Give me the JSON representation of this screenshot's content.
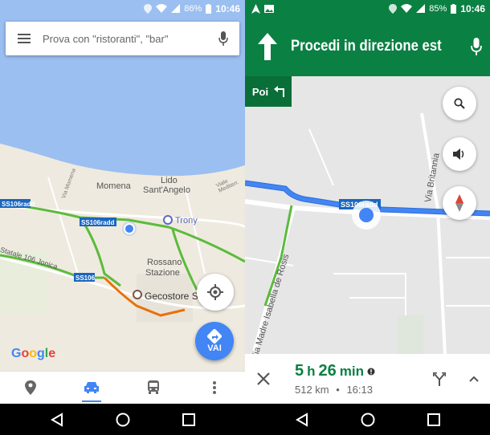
{
  "left": {
    "status": {
      "battery": "86%",
      "time": "10:46"
    },
    "search": {
      "placeholder": "Prova con \"ristoranti\", \"bar\""
    },
    "map_labels": {
      "momena": "Momena",
      "lido": "Lido",
      "santangelo": "Sant'Angelo",
      "trony": "Trony",
      "rossano": "Rossano",
      "stazione": "Stazione",
      "gecostore": "Gecostore S",
      "statale": "Statale 106 Jonica",
      "ss106radd_a": "SS106radd",
      "ss106radd_b": "SS106radd",
      "ss106": "SS106",
      "via_momena": "Via Momena",
      "viale": "Viale Mediterr."
    },
    "vai_label": "VAI",
    "google": "Google"
  },
  "right": {
    "status": {
      "battery": "85%",
      "time": "10:46"
    },
    "instruction": "Procedi in direzione est",
    "then_label": "Poi",
    "map_labels": {
      "via_britannia": "Via Britannia",
      "madre": "Via Madre Isabella de Rosis",
      "ss106radd": "SS106radd"
    },
    "trip": {
      "eta_h": "5",
      "eta_h_unit": "h",
      "eta_m": "26",
      "eta_m_unit": "min",
      "distance": "512 km",
      "separator": "•",
      "arrival": "16:13"
    }
  },
  "colors": {
    "nav_green": "#0b8043",
    "route_blue": "#4285f4",
    "sea": "#9bbff0",
    "traffic_green": "#5bbb3c",
    "traffic_orange": "#e8710a"
  },
  "icons": [
    "menu-icon",
    "mic-icon",
    "my-location-icon",
    "directions-icon",
    "explore-icon",
    "car-icon",
    "transit-icon",
    "more-icon",
    "back-icon",
    "home-icon",
    "recents-icon",
    "straight-arrow-icon",
    "turn-left-icon",
    "search-icon",
    "volume-icon",
    "compass-icon",
    "close-icon",
    "alternate-routes-icon",
    "chevron-up-icon"
  ]
}
